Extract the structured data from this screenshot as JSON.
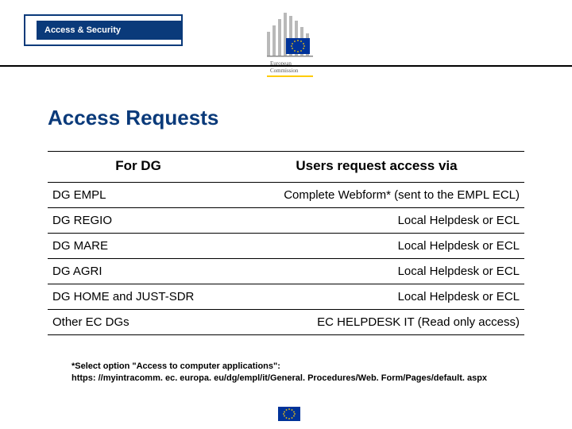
{
  "header": {
    "tab_label": "Access & Security",
    "logo_alt": "European Commission"
  },
  "title": "Access Requests",
  "table": {
    "head": {
      "col1": "For DG",
      "col2": "Users request access via"
    },
    "rows": [
      {
        "dg": "DG EMPL",
        "via": "Complete Webform* (sent to the EMPL ECL)"
      },
      {
        "dg": "DG REGIO",
        "via": "Local Helpdesk or ECL"
      },
      {
        "dg": "DG MARE",
        "via": "Local Helpdesk or ECL"
      },
      {
        "dg": "DG AGRI",
        "via": "Local Helpdesk or ECL"
      },
      {
        "dg": "DG HOME and JUST-SDR",
        "via": "Local Helpdesk or ECL"
      },
      {
        "dg": "Other EC DGs",
        "via": "EC HELPDESK IT (Read only access)"
      }
    ]
  },
  "footnote": {
    "line1": "*Select option \"Access to computer applications\":",
    "line2": "https: //myintracomm. ec. europa. eu/dg/empl/it/General. Procedures/Web. Form/Pages/default. aspx"
  }
}
